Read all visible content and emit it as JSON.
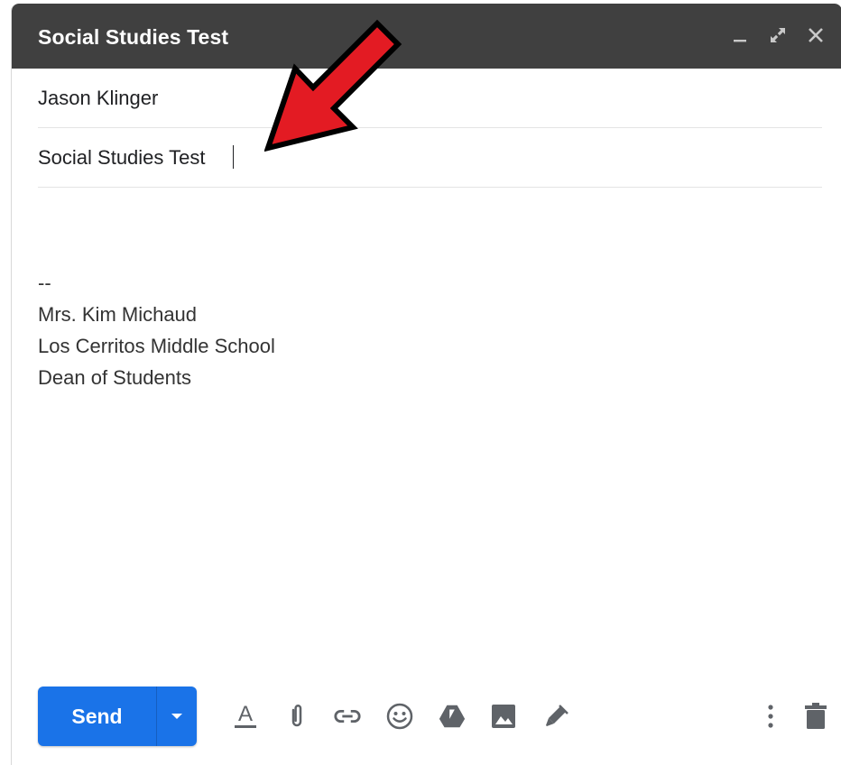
{
  "window": {
    "title": "Social Studies Test",
    "controls": [
      "minimize-icon",
      "expand-icon",
      "close-icon"
    ]
  },
  "compose": {
    "to": "Jason Klinger",
    "subject": "Social Studies Test",
    "signature": [
      "--",
      "Mrs. Kim Michaud",
      "Los Cerritos Middle School",
      "Dean of Students"
    ]
  },
  "toolbar": {
    "send_label": "Send",
    "tools": [
      "formatting-icon",
      "attach-icon",
      "link-icon",
      "emoji-icon",
      "drive-icon",
      "photo-icon",
      "signature-pen-icon",
      "more-options-icon",
      "trash-icon"
    ]
  },
  "colors": {
    "titlebar": "#404040",
    "send": "#1a73e8",
    "arrow": "#e31b23",
    "icon": "#5f6368"
  }
}
